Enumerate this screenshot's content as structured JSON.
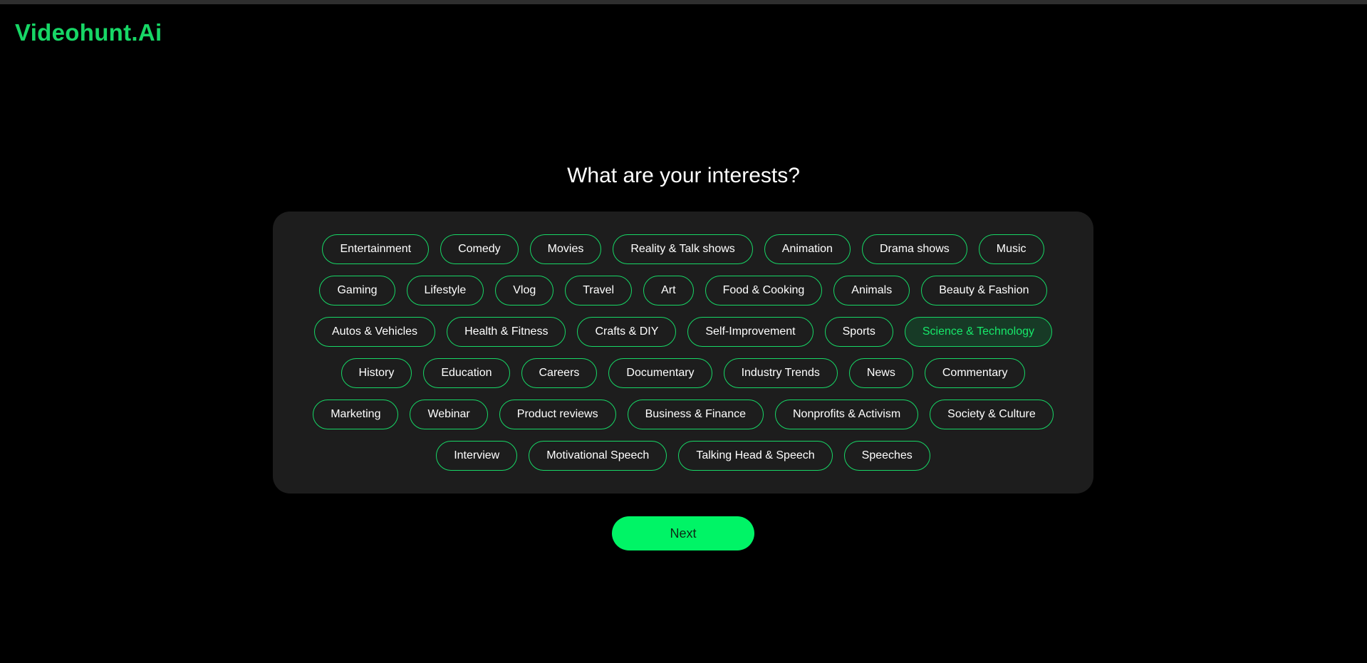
{
  "app": {
    "logo": "Videohunt.Ai"
  },
  "page": {
    "heading": "What are your interests?"
  },
  "colors": {
    "accent": "#17d766",
    "button": "#00f466",
    "panel": "#1d1d1d",
    "background": "#000000"
  },
  "selected_tag": "Science & Technology",
  "tag_rows": [
    [
      "Entertainment",
      "Comedy",
      "Movies",
      "Reality & Talk shows",
      "Animation",
      "Drama shows",
      "Music"
    ],
    [
      "Gaming",
      "Lifestyle",
      "Vlog",
      "Travel",
      "Art",
      "Food & Cooking",
      "Animals",
      "Beauty & Fashion"
    ],
    [
      "Autos & Vehicles",
      "Health & Fitness",
      "Crafts & DIY",
      "Self-Improvement",
      "Sports",
      "Science & Technology"
    ],
    [
      "History",
      "Education",
      "Careers",
      "Documentary",
      "Industry Trends",
      "News",
      "Commentary"
    ],
    [
      "Marketing",
      "Webinar",
      "Product reviews",
      "Business & Finance",
      "Nonprofits & Activism",
      "Society & Culture"
    ],
    [
      "Interview",
      "Motivational Speech",
      "Talking Head & Speech",
      "Speeches"
    ]
  ],
  "actions": {
    "next_label": "Next"
  }
}
